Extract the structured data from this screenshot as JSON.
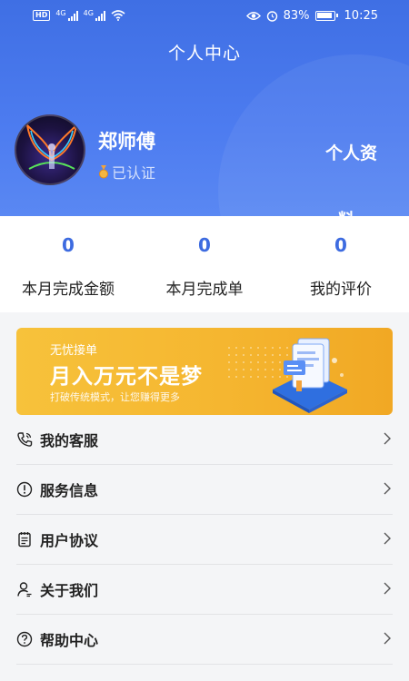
{
  "status_bar": {
    "left_chip": "HD",
    "sim1_label": "4G",
    "sim2_label": "4G",
    "battery": "83%",
    "time": "10:25"
  },
  "header": {
    "title": "个人中心"
  },
  "user": {
    "name": "郑师傅",
    "verify_status": "已认证",
    "profile_link_line1": "个人资",
    "profile_link_line2": "料"
  },
  "stats": [
    {
      "value": "0",
      "label": "本月完成金额"
    },
    {
      "value": "0",
      "label": "本月完成单"
    },
    {
      "value": "0",
      "label": "我的评价"
    }
  ],
  "banner": {
    "small_title": "无忧接单",
    "headline": "月入万元不是梦",
    "subtitle": "打破传统模式，让您赚得更多"
  },
  "menu": [
    {
      "label": "我的客服",
      "icon": "phone-icon"
    },
    {
      "label": "服务信息",
      "icon": "info-icon"
    },
    {
      "label": "用户协议",
      "icon": "document-icon"
    },
    {
      "label": "关于我们",
      "icon": "person-icon"
    },
    {
      "label": "帮助中心",
      "icon": "help-icon"
    }
  ],
  "colors": {
    "header_blue": "#4d7cf0",
    "stat_blue": "#3d6be0",
    "banner_yellow": "#f5b630"
  }
}
